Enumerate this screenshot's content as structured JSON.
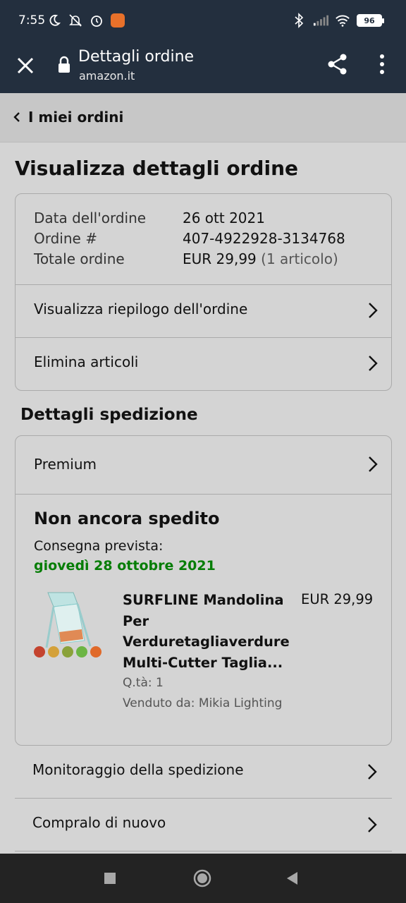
{
  "status_bar": {
    "time": "7:55",
    "battery": "96",
    "left_icons": [
      "moon-icon",
      "bell-off-icon",
      "alarm-icon",
      "app-icon"
    ],
    "right_icons": [
      "bluetooth-icon",
      "signal-icon",
      "wifi-icon",
      "battery-icon"
    ]
  },
  "browser": {
    "title": "Dettagli ordine",
    "domain": "amazon.it"
  },
  "back": {
    "label": "I miei ordini"
  },
  "main": {
    "title": "Visualizza dettagli ordine"
  },
  "order": {
    "date_label": "Data dell'ordine",
    "date_value": "26 ott 2021",
    "number_label": "Ordine #",
    "number_value": "407-4922928-3134768",
    "total_label": "Totale ordine",
    "total_value": "EUR 29,99",
    "total_items": "(1 articolo)",
    "summary_link": "Visualizza riepilogo dell'ordine",
    "delete_link": "Elimina articoli"
  },
  "shipping": {
    "section_title": "Dettagli spedizione",
    "premium_label": "Premium",
    "status": "Non ancora spedito",
    "delivery_label": "Consegna prevista:",
    "delivery_date": "giovedì 28 ottobre 2021",
    "product": {
      "title": "SURFLINE Mandolina Per Verduretagliaverdure Multi-Cutter Taglia...",
      "price": "EUR 29,99",
      "qty": "Q.tà: 1",
      "seller": "Venduto da: Mikia Lighting"
    }
  },
  "actions": {
    "track": "Monitoraggio della spedizione",
    "buy_again": "Compralo di nuovo"
  },
  "colors": {
    "header_bg": "#232f3e",
    "delivery_green": "#067d06",
    "page_bg": "#d4d4d4"
  }
}
